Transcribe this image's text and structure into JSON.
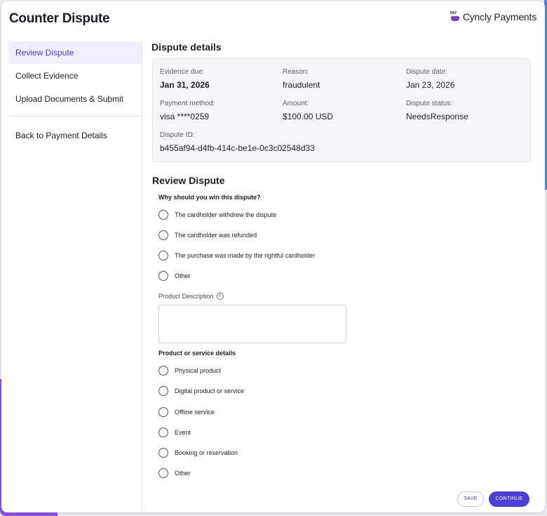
{
  "header": {
    "title": "Counter Dispute",
    "brand_mark": "PAY",
    "brand_name": "Cyncly Payments"
  },
  "sidebar": {
    "items": [
      {
        "label": "Review Dispute",
        "active": true
      },
      {
        "label": "Collect Evidence",
        "active": false
      },
      {
        "label": "Upload Documents & Submit",
        "active": false
      }
    ],
    "back_label": "Back to Payment Details"
  },
  "details": {
    "heading": "Dispute details",
    "evidence_due": {
      "label": "Evidence due:",
      "value": "Jan 31, 2026"
    },
    "reason": {
      "label": "Reason:",
      "value": "fraudulent"
    },
    "dispute_date": {
      "label": "Dispute date:",
      "value": "Jan 23, 2026"
    },
    "payment_method": {
      "label": "Payment method:",
      "value": "visa ****0259"
    },
    "amount": {
      "label": "Amount:",
      "value": "$100.00 USD"
    },
    "dispute_status": {
      "label": "Dispute status:",
      "value": "NeedsResponse"
    },
    "dispute_id": {
      "label": "Dispute ID:",
      "value": "b455af94-d4fb-414c-be1e-0c3c02548d33"
    }
  },
  "review": {
    "heading": "Review Dispute",
    "question": "Why should you win this dispute?",
    "options": [
      "The cardholder withdrew the dispute",
      "The cardholder was refunded",
      "The purchase was made by the rightful cardholder",
      "Other"
    ],
    "product_description_label": "Product Description",
    "product_description_value": "",
    "info_icon": "info-icon",
    "service_question": "Product or service details",
    "service_options": [
      "Physical product",
      "Digital product or service",
      "Offline service",
      "Event",
      "Booking or reservation",
      "Other"
    ]
  },
  "actions": {
    "save_label": "SAVE",
    "continue_label": "CONTINUE"
  },
  "colors": {
    "accent": "#4b3fd6",
    "brand_purple": "#7a3fe0",
    "active_bg": "#f0eefc"
  }
}
